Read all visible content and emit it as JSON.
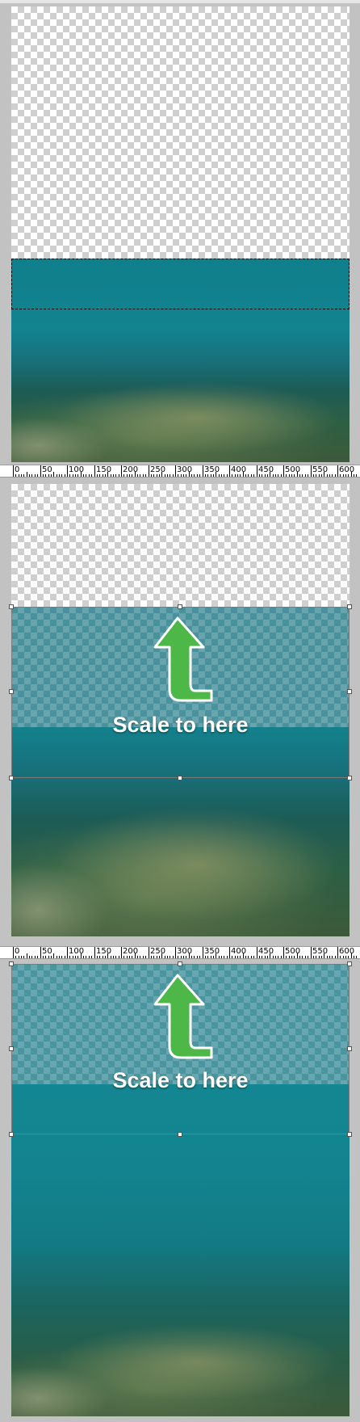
{
  "caption": "Scale to here",
  "ruler": {
    "labels": [
      "0",
      "50",
      "100",
      "150",
      "200",
      "250",
      "300",
      "350",
      "400",
      "450",
      "500",
      "550",
      "600"
    ]
  },
  "colors": {
    "arrow_fill": "#4db848",
    "arrow_stroke": "#ffffff",
    "selection_border": "#ffffff",
    "water": "#12838f"
  },
  "icons": [
    "up-arrow-icon",
    "transform-handle"
  ]
}
